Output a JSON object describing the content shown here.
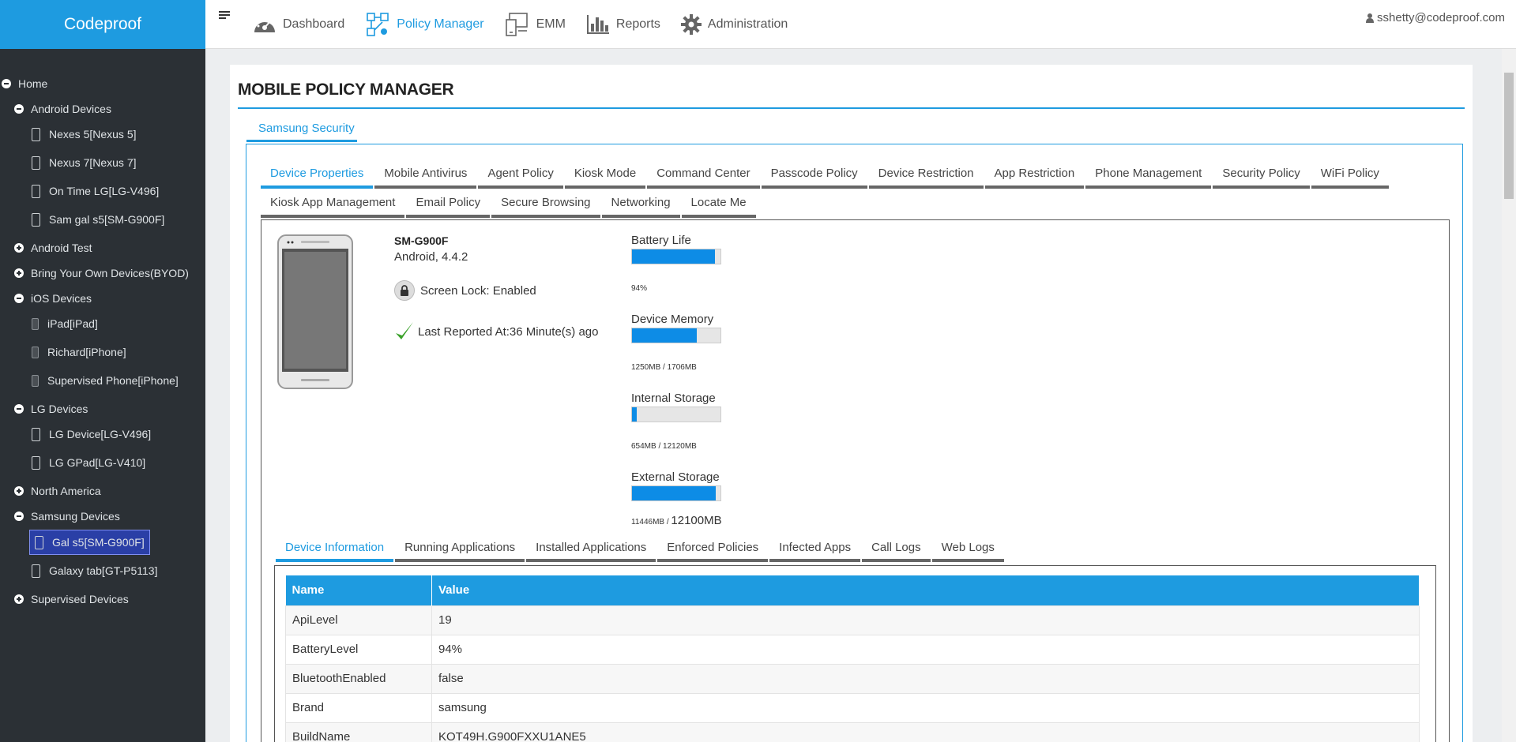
{
  "brand": "Codeproof",
  "nav": [
    {
      "label": "Dashboard",
      "icon": "dashboard-icon"
    },
    {
      "label": "Policy Manager",
      "icon": "policy-network-icon",
      "active": true
    },
    {
      "label": "EMM",
      "icon": "devices-icon"
    },
    {
      "label": "Reports",
      "icon": "bar-chart-icon"
    },
    {
      "label": "Administration",
      "icon": "gear-icon"
    }
  ],
  "user": "sshetty@codeproof.com",
  "sidebar": {
    "home": "Home",
    "android_devices": "Android Devices",
    "android_items": [
      "Nexes 5[Nexus 5]",
      "Nexus 7[Nexus 7]",
      "On Time LG[LG-V496]",
      "Sam gal s5[SM-G900F]"
    ],
    "android_test": "Android Test",
    "byod": "Bring Your Own Devices(BYOD)",
    "ios_devices": "iOS Devices",
    "ios_items": [
      "iPad[iPad]",
      "Richard[iPhone]",
      "Supervised Phone[iPhone]"
    ],
    "lg_devices": "LG Devices",
    "lg_items": [
      "LG Device[LG-V496]",
      "LG GPad[LG-V410]"
    ],
    "north_america": "North America",
    "samsung_devices": "Samsung Devices",
    "samsung_items": [
      "Gal s5[SM-G900F]",
      "Galaxy tab[GT-P5113]"
    ],
    "supervised_devices": "Supervised Devices"
  },
  "page_title": "MOBILE POLICY MANAGER",
  "outer_tab": "Samsung Security",
  "policy_tabs_row1": [
    "Device Properties",
    "Mobile Antivirus",
    "Agent Policy",
    "Kiosk Mode",
    "Command Center",
    "Passcode Policy",
    "Device Restriction",
    "App Restriction",
    "Phone Management",
    "Security Policy",
    "WiFi Policy"
  ],
  "policy_tabs_row2": [
    "Kiosk App Management",
    "Email Policy",
    "Secure Browsing",
    "Networking",
    "Locate Me"
  ],
  "device": {
    "model": "SM-G900F",
    "os": "Android, 4.4.2",
    "screen_lock": "Screen Lock: Enabled",
    "last_reported": "Last Reported At:36 Minute(s) ago"
  },
  "meters": [
    {
      "label": "Battery Life",
      "fraction": 0.94,
      "caption": "94%",
      "caption_big": ""
    },
    {
      "label": "Device Memory",
      "fraction": 0.733,
      "caption": "1250MB / 1706MB",
      "caption_big": ""
    },
    {
      "label": "Internal Storage",
      "fraction": 0.054,
      "caption": "654MB / 12120MB",
      "caption_big": ""
    },
    {
      "label": "External Storage",
      "fraction": 0.946,
      "caption": "11446MB / ",
      "caption_big": "12100MB"
    }
  ],
  "info_tabs": [
    "Device Information",
    "Running Applications",
    "Installed Applications",
    "Enforced Policies",
    "Infected Apps",
    "Call Logs",
    "Web Logs"
  ],
  "table": {
    "headers": [
      "Name",
      "Value"
    ],
    "rows": [
      [
        "ApiLevel",
        "19"
      ],
      [
        "BatteryLevel",
        "94%"
      ],
      [
        "BluetoothEnabled",
        "false"
      ],
      [
        "Brand",
        "samsung"
      ],
      [
        "BuildName",
        "KOT49H.G900FXXU1ANE5"
      ]
    ]
  },
  "colors": {
    "accent": "#1e9be0",
    "sidebar_bg": "#2b3035",
    "selected_bg": "#2a3fa6",
    "meter_fill": "#0d8ce6"
  }
}
